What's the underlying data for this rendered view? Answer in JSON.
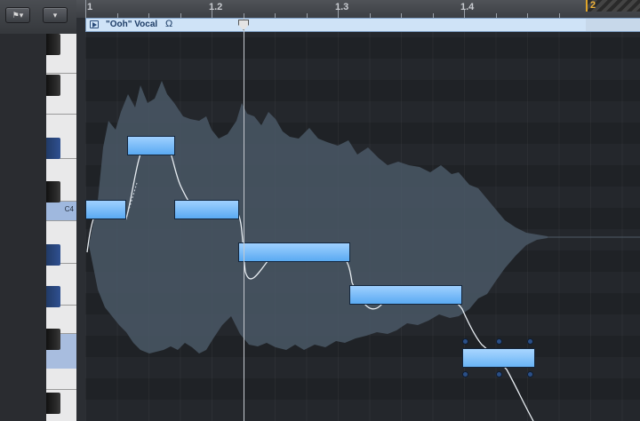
{
  "toolbar": {
    "buttons": [
      {
        "icon": "flag-dropdown-icon",
        "glyph": "⚑▾"
      },
      {
        "icon": "chevron-down-icon",
        "glyph": "▾"
      }
    ]
  },
  "ruler": {
    "bars": [
      {
        "label": "1",
        "x": 0
      },
      {
        "label": "1.2",
        "x": 1
      },
      {
        "label": "1.3",
        "x": 2
      },
      {
        "label": "1.4",
        "x": 3
      }
    ],
    "locator_label": "2"
  },
  "region": {
    "name": "\"Ooh\" Vocal",
    "omega": "Ω"
  },
  "keyboard": {
    "selected_key_label": "C4"
  },
  "colors": {
    "note": "#6fb8f7",
    "waveform": "#4a5866",
    "pitch_curve": "#e8edf2",
    "locator": "#f0b33a"
  }
}
